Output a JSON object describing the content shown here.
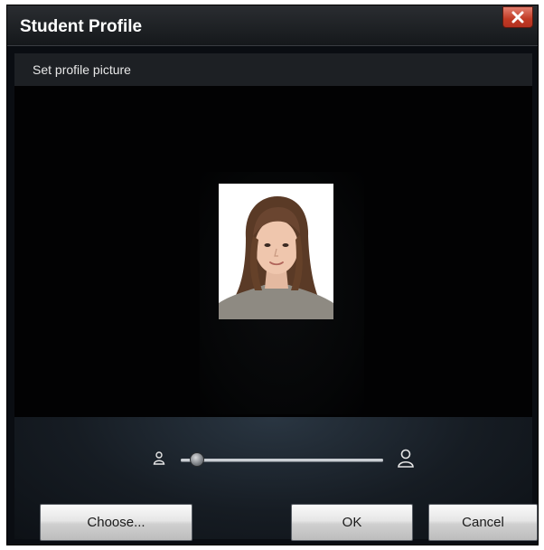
{
  "window": {
    "title": "Student Profile",
    "close_icon": "close-icon"
  },
  "subheader": {
    "label": "Set profile picture"
  },
  "preview": {
    "photo_description_icon": "profile-photo"
  },
  "zoom": {
    "min_icon": "person-small-icon",
    "max_icon": "person-large-icon",
    "level": 0.05
  },
  "buttons": {
    "choose": "Choose...",
    "ok": "OK",
    "cancel": "Cancel"
  },
  "colors": {
    "close_red": "#c03a24",
    "background_dark": "#0a0d12",
    "panel": "#1d2024"
  }
}
